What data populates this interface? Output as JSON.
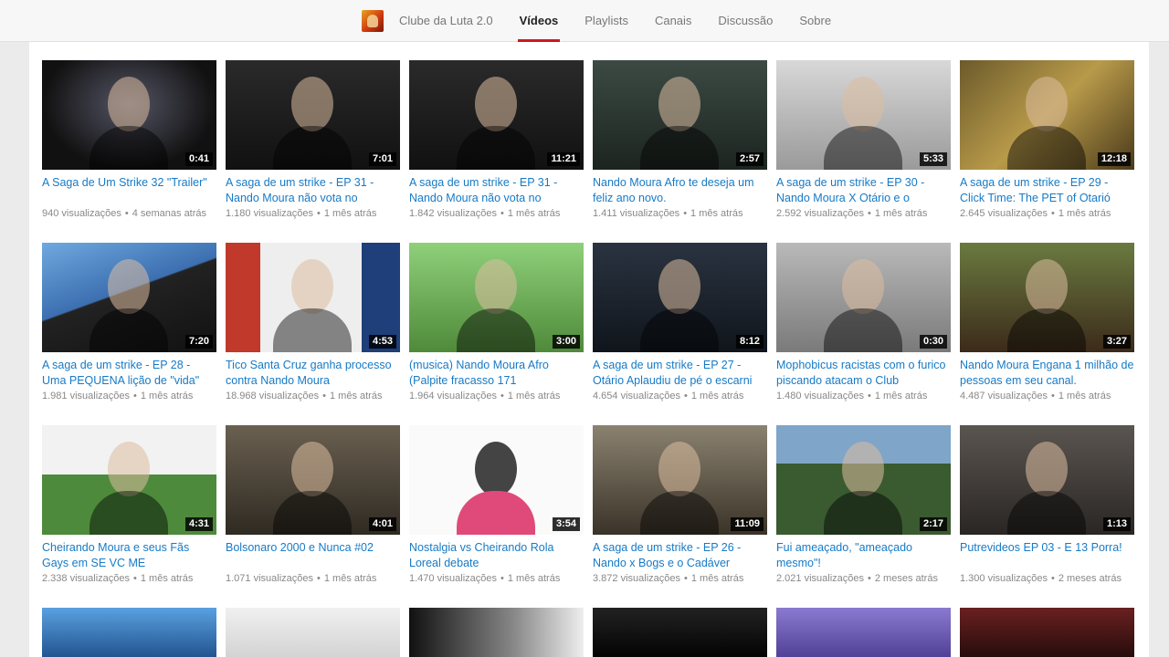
{
  "nav": {
    "channel_name": "Clube da Luta 2.0",
    "tabs": [
      "Vídeos",
      "Playlists",
      "Canais",
      "Discussão",
      "Sobre"
    ],
    "active_tab": "Vídeos"
  },
  "videos": [
    {
      "title": "A Saga de Um Strike 32 \"Trailer\"",
      "views": "940 visualizações",
      "age": "4 semanas atrás",
      "duration": "0:41",
      "thumb_icon": "dark-figure-thumbnail"
    },
    {
      "title": "A saga de um strike - EP 31 - Nando Moura não vota no",
      "views": "1.180 visualizações",
      "age": "1 mês atrás",
      "duration": "7:01",
      "thumb_icon": "bunny-mask-thumbnail"
    },
    {
      "title": "A saga de um strike - EP 31 - Nando Moura não vota no",
      "views": "1.842 visualizações",
      "age": "1 mês atrás",
      "duration": "11:21",
      "thumb_icon": "bunny-mask-thumbnail"
    },
    {
      "title": "Nando Moura Afro te deseja um feliz ano novo.",
      "views": "1.411 visualizações",
      "age": "1 mês atrás",
      "duration": "2:57",
      "thumb_icon": "chair-figure-thumbnail"
    },
    {
      "title": "A saga de um strike - EP 30 - Nando Moura X Otário e o",
      "views": "2.592 visualizações",
      "age": "1 mês atrás",
      "duration": "5:33",
      "thumb_icon": "white-mask-thumbnail"
    },
    {
      "title": "A saga de um strike - EP 29 - Click Time: The PET of Otarió",
      "views": "2.645 visualizações",
      "age": "1 mês atrás",
      "duration": "12:18",
      "thumb_icon": "tablet-man-thumbnail"
    },
    {
      "title": "A saga de um strike - EP 28 - Uma PEQUENA lição de \"vida\"",
      "views": "1.981 visualizações",
      "age": "1 mês atrás",
      "duration": "7:20",
      "thumb_icon": "anime-thumbnail"
    },
    {
      "title": "Tico Santa Cruz ganha processo contra Nando Moura",
      "views": "18.968 visualizações",
      "age": "1 mês atrás",
      "duration": "4:53",
      "thumb_icon": "collage-thumbnail"
    },
    {
      "title": "(musica) Nando Moura Afro (Palpite fracasso 171",
      "views": "1.964 visualizações",
      "age": "1 mês atrás",
      "duration": "3:00",
      "thumb_icon": "guitar-man-thumbnail"
    },
    {
      "title": "A saga de um strike - EP 27 - Otário Aplaudiu de pé o escarni",
      "views": "4.654 visualizações",
      "age": "1 mês atrás",
      "duration": "8:12",
      "thumb_icon": "mask-thumbnail"
    },
    {
      "title": "Mophobicus racistas com o furico piscando atacam o Club",
      "views": "1.480 visualizações",
      "age": "1 mês atrás",
      "duration": "0:30",
      "thumb_icon": "guy-fawkes-thumbnail"
    },
    {
      "title": "Nando Moura Engana 1 milhão de pessoas em seu canal.",
      "views": "4.487 visualizações",
      "age": "1 mês atrás",
      "duration": "3:27",
      "thumb_icon": "party-thumbnail"
    },
    {
      "title": "Cheirando Moura e seus Fãs Gays em SE VC ME CONTRARIAR",
      "views": "2.338 visualizações",
      "age": "1 mês atrás",
      "duration": "4:31",
      "thumb_icon": "girl-field-thumbnail"
    },
    {
      "title": "Bolsonaro 2000 e Nunca #02",
      "views": "1.071 visualizações",
      "age": "1 mês atrás",
      "duration": "4:01",
      "thumb_icon": "crowd-thumbnail"
    },
    {
      "title": "Nostalgia vs Cheirando Rola Loreal debate",
      "views": "1.470 visualizações",
      "age": "1 mês atrás",
      "duration": "3:54",
      "thumb_icon": "cartoon-thumbnail"
    },
    {
      "title": "A saga de um strike - EP 26 - Nando x Bogs e o Cadáver",
      "views": "3.872 visualizações",
      "age": "1 mês atrás",
      "duration": "11:09",
      "thumb_icon": "comic-thumbnail"
    },
    {
      "title": "Fui ameaçado, \"ameaçado mesmo\"!",
      "views": "2.021 visualizações",
      "age": "2 meses atrás",
      "duration": "2:17",
      "thumb_icon": "outdoor-man-thumbnail"
    },
    {
      "title": "Putrevideos EP 03 - E 13 Porra!",
      "views": "1.300 visualizações",
      "age": "2 meses atrás",
      "duration": "1:13",
      "thumb_icon": "doll-thumbnail"
    }
  ],
  "partial_row": [
    "blue-thumbnail",
    "document-thumbnail",
    "bw-thumbnail",
    "dark-thumbnail",
    "purple-thumbnail",
    "red-thumbnail"
  ],
  "meta_separator": "•"
}
